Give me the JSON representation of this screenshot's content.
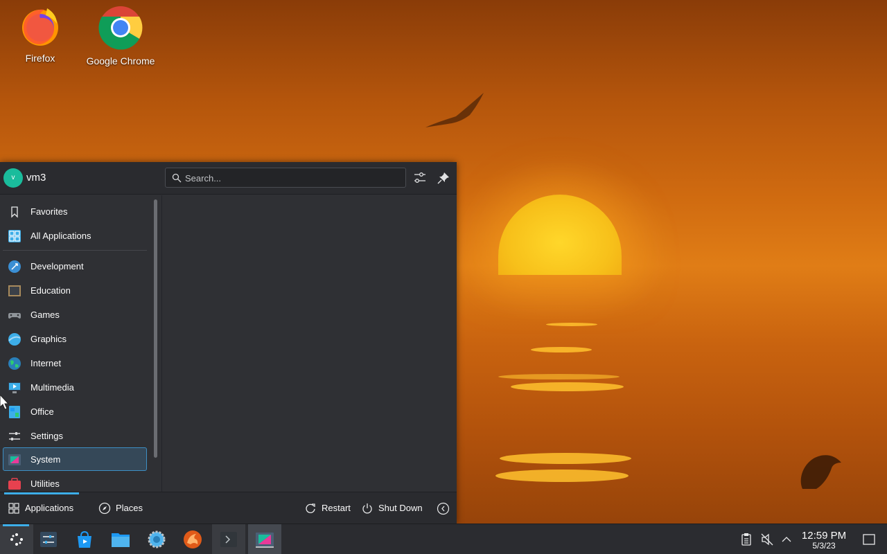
{
  "desktop": {
    "icons": [
      {
        "label": "Firefox",
        "icon": "firefox-icon"
      },
      {
        "label": "Google Chrome",
        "icon": "chrome-icon"
      }
    ]
  },
  "launcher": {
    "user": {
      "name": "vm3",
      "avatar_letter": "v"
    },
    "search": {
      "placeholder": "Search..."
    },
    "header_buttons": [
      "configure-icon",
      "pin-icon"
    ],
    "favorites": [
      {
        "label": "Favorites",
        "icon": "bookmark-icon"
      },
      {
        "label": "All Applications",
        "icon": "all-applications-icon"
      }
    ],
    "categories": [
      {
        "label": "Development",
        "icon": "development-icon"
      },
      {
        "label": "Education",
        "icon": "education-icon"
      },
      {
        "label": "Games",
        "icon": "games-icon"
      },
      {
        "label": "Graphics",
        "icon": "graphics-icon"
      },
      {
        "label": "Internet",
        "icon": "internet-icon"
      },
      {
        "label": "Multimedia",
        "icon": "multimedia-icon"
      },
      {
        "label": "Office",
        "icon": "office-icon"
      },
      {
        "label": "Settings",
        "icon": "settings-icon"
      },
      {
        "label": "System",
        "icon": "system-icon",
        "selected": true
      },
      {
        "label": "Utilities",
        "icon": "utilities-icon"
      }
    ],
    "footer": {
      "applications": "Applications",
      "places": "Places",
      "restart": "Restart",
      "shutdown": "Shut Down"
    }
  },
  "taskbar": {
    "items": [
      "application-launcher-icon",
      "system-settings-icon",
      "discover-icon",
      "file-manager-icon",
      "system-monitor-icon",
      "krusader-icon",
      "terminal-icon",
      "window-icon"
    ],
    "clock": {
      "time": "12:59 PM",
      "date": "5/3/23"
    }
  },
  "colors": {
    "accent": "#3daee9",
    "panel": "#2f3034",
    "selected_bg": "#354858"
  }
}
